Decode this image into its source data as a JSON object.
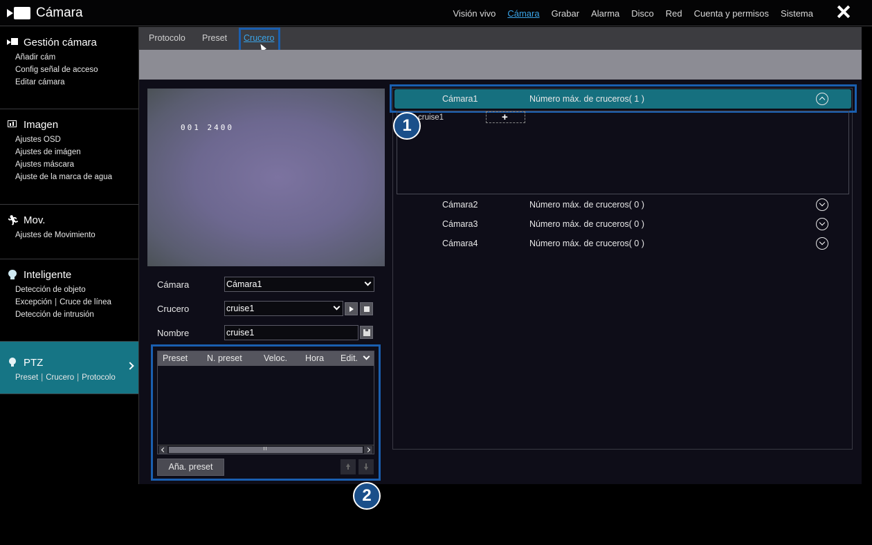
{
  "app": {
    "title": "Cámara"
  },
  "topnav": {
    "items": [
      "Visión vivo",
      "Cámara",
      "Grabar",
      "Alarma",
      "Disco",
      "Red",
      "Cuenta y permisos",
      "Sistema"
    ],
    "active_index": 1
  },
  "sidebar": {
    "sections": [
      {
        "title": "Gestión cámara",
        "icon": "camera-icon",
        "items": [
          "Añadir cám",
          "Config señal de acceso",
          "Editar cámara"
        ]
      },
      {
        "title": "Imagen",
        "icon": "image-settings-icon",
        "items": [
          "Ajustes OSD",
          "Ajustes de imágen",
          "Ajustes máscara",
          "Ajuste de la marca de agua"
        ]
      },
      {
        "title": "Mov.",
        "icon": "running-person-icon",
        "items": [
          "Ajustes de Movimiento"
        ]
      },
      {
        "title": "Inteligente",
        "icon": "brain-icon",
        "items": [
          "Detección de objeto",
          "Excepción",
          "Cruce de línea",
          "Detección de intrusión"
        ]
      },
      {
        "title": "PTZ",
        "icon": "ptz-icon",
        "items": [
          "Preset",
          "Crucero",
          "Protocolo"
        ]
      }
    ]
  },
  "subtabs": {
    "items": [
      "Protocolo",
      "Preset",
      "Crucero"
    ],
    "active_index": 2
  },
  "preview": {
    "osd_text": "001 2400"
  },
  "form": {
    "camera_label": "Cámara",
    "camera_value": "Cámara1",
    "cruise_label": "Crucero",
    "cruise_value": "cruise1",
    "name_label": "Nombre",
    "name_value": "cruise1"
  },
  "preset_table": {
    "columns": [
      "Preset",
      "N. preset",
      "Veloc.",
      "Hora",
      "Edit."
    ],
    "rows": []
  },
  "add_preset_label": "Aña. preset",
  "camera_list": [
    {
      "name": "Cámara1",
      "max_label": "Número máx. de cruceros( 1 )",
      "expanded": true,
      "cruises": [
        "cruise1"
      ]
    },
    {
      "name": "Cámara2",
      "max_label": "Número máx. de cruceros( 0 )",
      "expanded": false
    },
    {
      "name": "Cámara3",
      "max_label": "Número máx. de cruceros( 0 )",
      "expanded": false
    },
    {
      "name": "Cámara4",
      "max_label": "Número máx. de cruceros( 0 )",
      "expanded": false
    }
  ],
  "add_cruise_symbol": "+",
  "callouts": [
    "1",
    "2"
  ],
  "colors": {
    "accent": "#16707f",
    "link": "#3aa4e8",
    "callout": "#1a4f8a"
  }
}
